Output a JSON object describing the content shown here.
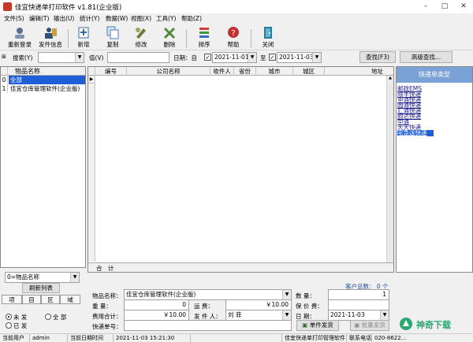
{
  "window": {
    "title": "佳宜快递单打印软件 v1.81(企业版)",
    "controls": [
      "–",
      "□",
      "✕"
    ]
  },
  "menu": [
    "文件(S)",
    "编辑(T)",
    "输出(U)",
    "统计(Y)",
    "数据(W)",
    "视图(X)",
    "工具(Y)",
    "帮助(Z)"
  ],
  "toolbar": [
    {
      "label": "重新登录",
      "icon": "relogin-icon",
      "color": "#5a6f8a"
    },
    {
      "label": "发件信息",
      "icon": "sender-info-icon",
      "color": "#2e4f7a"
    },
    {
      "label": "新增",
      "icon": "add-icon",
      "color": "#3b6aa0"
    },
    {
      "label": "复制",
      "icon": "copy-icon",
      "color": "#4a7ab5"
    },
    {
      "label": "修改",
      "icon": "edit-icon",
      "color": "#6b7b3a"
    },
    {
      "label": "删除",
      "icon": "delete-icon",
      "color": "#4a8a3a"
    },
    {
      "label": "排序",
      "icon": "sort-icon",
      "color": "#d04030"
    },
    {
      "label": "帮助",
      "icon": "help-icon",
      "color": "#c43030"
    },
    {
      "label": "关闭",
      "icon": "close-app-icon",
      "color": "#2a7a9a"
    }
  ],
  "filter": {
    "search_label": "搜索(Y)",
    "search_value": "",
    "value_label": "值(V)",
    "value_value": "",
    "date_label": "日期：自",
    "date_from": "2021-11-01",
    "date_to_label": "至",
    "date_to": "2021-11-03",
    "find_button": "查找(F3)",
    "advanced_button": "高级查找..."
  },
  "left_grid": {
    "header": "物品名称",
    "rows": [
      {
        "idx": "0",
        "text": "全部",
        "selected": true
      },
      {
        "idx": "1",
        "text": "佳宜仓库管理软件(企业版)",
        "selected": false
      }
    ]
  },
  "main_grid": {
    "columns": [
      "编号",
      "公司名称",
      "收件人",
      "省份",
      "城市",
      "城区",
      "地址"
    ],
    "row_marker": "▶",
    "footer": [
      "合",
      "计"
    ]
  },
  "right_panel": {
    "title": "快递单类型",
    "items": [
      "邮政EMS",
      "顺丰快递",
      "申通快递",
      "圆通快递",
      "汇通快递",
      "韵达快递",
      "中通",
      "天天快递",
      "宅急送快递"
    ],
    "selected_index": 8
  },
  "left_lower": {
    "combo_value": "0=物品名称",
    "refresh_button": "刷新列表",
    "tabs": [
      "项",
      "目",
      "区",
      "域"
    ],
    "radio": [
      {
        "label": "未  发",
        "checked": true
      },
      {
        "label": "全  部",
        "checked": false
      },
      {
        "label": "已  发",
        "checked": false
      }
    ]
  },
  "form": {
    "customer_count": "客户总数：  0  个",
    "item_name_label": "物品名称：",
    "item_name_value": "佳宜仓库管理软件(企业版)",
    "quantity_label": "数      量：",
    "quantity_value": "1",
    "weight_label": "重      量：",
    "weight_value": "0",
    "shipping_label": "运      费：",
    "shipping_value": "￥10.00",
    "insure_label": "保 价 费：",
    "insure_value": "",
    "total_label": "费用合计：",
    "total_value": "￥10.00",
    "sender_label": "发 件 人：",
    "sender_value": "刘  菲",
    "date_label": "日      期：",
    "date_value": "2021-11-03",
    "tracking_label": "快递单号：",
    "tracking_value": "",
    "single_ship_button": "单件发货",
    "batch_ship_button": "批量发货"
  },
  "status": {
    "user_label": "当前用户",
    "user": "admin",
    "time_label": "当前日期时间",
    "time": "2021-11-03 15:21:30",
    "product": "佳宜快递单打印管理软件",
    "contact_label": "联系电话",
    "contact": "020-8622..."
  },
  "watermark": {
    "text": "神奇下载",
    "color": "#2aa872"
  }
}
